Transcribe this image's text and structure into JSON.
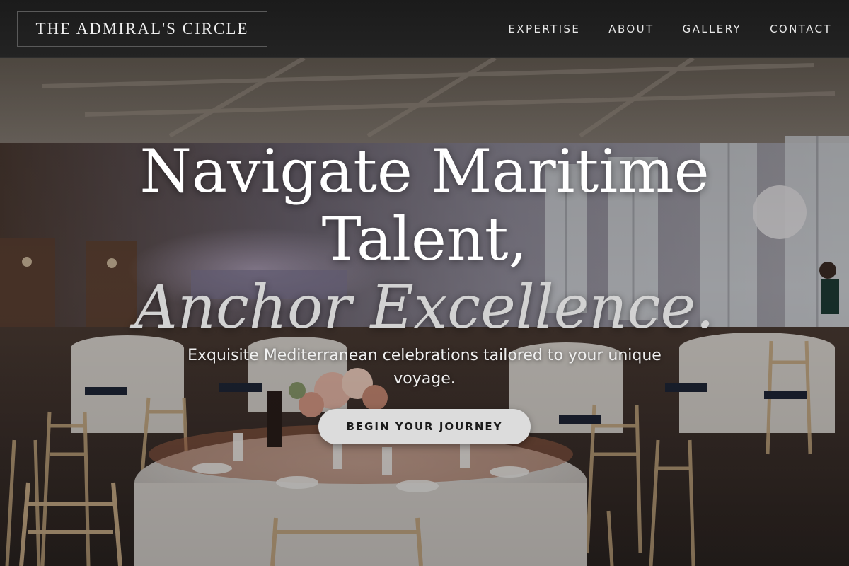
{
  "brand": {
    "logo_text": "THE ADMIRAL'S CIRCLE"
  },
  "nav": {
    "items": [
      {
        "label": "EXPERTISE"
      },
      {
        "label": "ABOUT"
      },
      {
        "label": "GALLERY"
      },
      {
        "label": "CONTACT"
      }
    ]
  },
  "hero": {
    "title_line1": "Navigate Maritime",
    "title_line2": "Talent,",
    "title_accent": "Anchor Excellence.",
    "subtitle": "Exquisite Mediterranean celebrations tailored to your unique voyage.",
    "cta_label": "BEGIN YOUR JOURNEY",
    "background_image": "banquet-hall-photo"
  },
  "colors": {
    "header_bg": "#1f1f1f",
    "cta_bg": "#dcdcdc",
    "text_primary": "#ffffff",
    "accent_text": "#d2d2d2"
  }
}
